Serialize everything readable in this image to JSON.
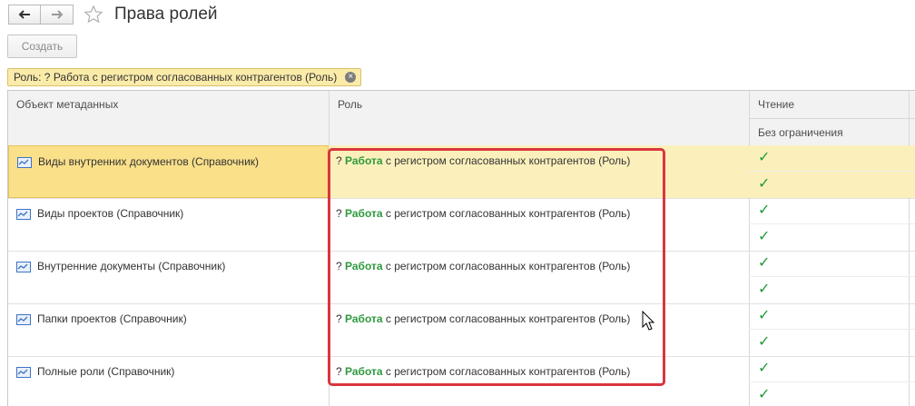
{
  "window": {
    "title": "Права ролей"
  },
  "nav": {
    "back_icon": "arrow-left-icon",
    "forward_icon": "arrow-right-icon",
    "favorite_icon": "star-icon"
  },
  "toolbar": {
    "create_label": "Создать"
  },
  "filter": {
    "label": "Роль: ? Работа с регистром согласованных контрагентов (Роль)",
    "clear_icon": "close-circle-icon"
  },
  "table": {
    "headers": {
      "object": "Объект метаданных",
      "role": "Роль",
      "read": "Чтение",
      "read_sub": "Без ограничения"
    },
    "rows": [
      {
        "object": "Виды внутренних документов (Справочник)",
        "role_prefix": "? ",
        "role_bold": "Работа",
        "role_rest": " с регистром согласованных контрагентов (Роль)",
        "read_checked": true,
        "read_unrestricted_checked": true,
        "selected": true
      },
      {
        "object": "Виды проектов (Справочник)",
        "role_prefix": "? ",
        "role_bold": "Работа",
        "role_rest": " с регистром согласованных контрагентов (Роль)",
        "read_checked": true,
        "read_unrestricted_checked": true,
        "selected": false
      },
      {
        "object": "Внутренние документы (Справочник)",
        "role_prefix": "? ",
        "role_bold": "Работа",
        "role_rest": " с регистром согласованных контрагентов (Роль)",
        "read_checked": true,
        "read_unrestricted_checked": true,
        "selected": false
      },
      {
        "object": "Папки проектов (Справочник)",
        "role_prefix": "? ",
        "role_bold": "Работа",
        "role_rest": " с регистром согласованных контрагентов (Роль)",
        "read_checked": true,
        "read_unrestricted_checked": true,
        "selected": false
      },
      {
        "object": "Полные роли (Справочник)",
        "role_prefix": "? ",
        "role_bold": "Работа",
        "role_rest": " с регистром согласованных контрагентов (Роль)",
        "read_checked": true,
        "read_unrestricted_checked": true,
        "selected": false
      }
    ],
    "check_glyph": "✓",
    "catalog_icon": "catalog-icon"
  },
  "colors": {
    "highlight_border": "#d9363e",
    "role_bold": "#2e9a3e",
    "check": "#1f9a3a",
    "selected_row": "#fbf0bb"
  }
}
